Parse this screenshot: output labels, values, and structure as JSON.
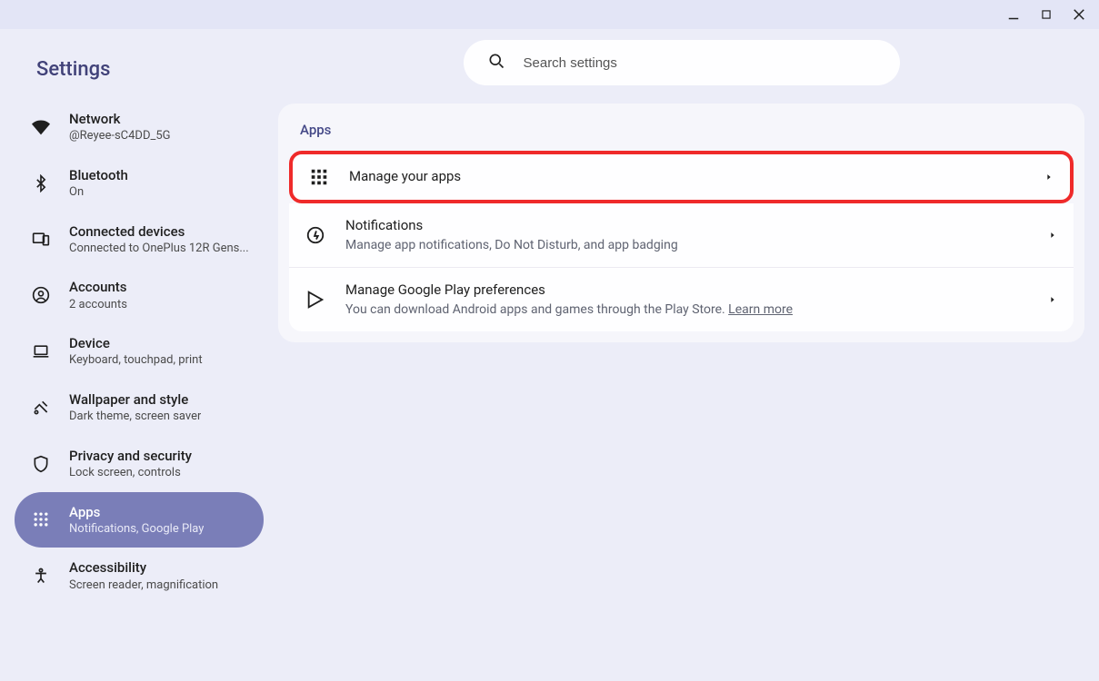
{
  "window": {
    "minimize": "–",
    "maximize": "□",
    "close": "×"
  },
  "app_title": "Settings",
  "search": {
    "placeholder": "Search settings"
  },
  "sidebar": {
    "items": [
      {
        "title": "Network",
        "sub": "@Reyee-sC4DD_5G"
      },
      {
        "title": "Bluetooth",
        "sub": "On"
      },
      {
        "title": "Connected devices",
        "sub": "Connected to OnePlus 12R Gens..."
      },
      {
        "title": "Accounts",
        "sub": "2 accounts"
      },
      {
        "title": "Device",
        "sub": "Keyboard, touchpad, print"
      },
      {
        "title": "Wallpaper and style",
        "sub": "Dark theme, screen saver"
      },
      {
        "title": "Privacy and security",
        "sub": "Lock screen, controls"
      },
      {
        "title": "Apps",
        "sub": "Notifications, Google Play"
      },
      {
        "title": "Accessibility",
        "sub": "Screen reader, magnification"
      }
    ]
  },
  "section": {
    "title": "Apps"
  },
  "rows": [
    {
      "title": "Manage your apps",
      "sub": ""
    },
    {
      "title": "Notifications",
      "sub": "Manage app notifications, Do Not Disturb, and app badging"
    },
    {
      "title": "Manage Google Play preferences",
      "sub": "You can download Android apps and games through the Play Store. ",
      "link": "Learn more"
    }
  ]
}
